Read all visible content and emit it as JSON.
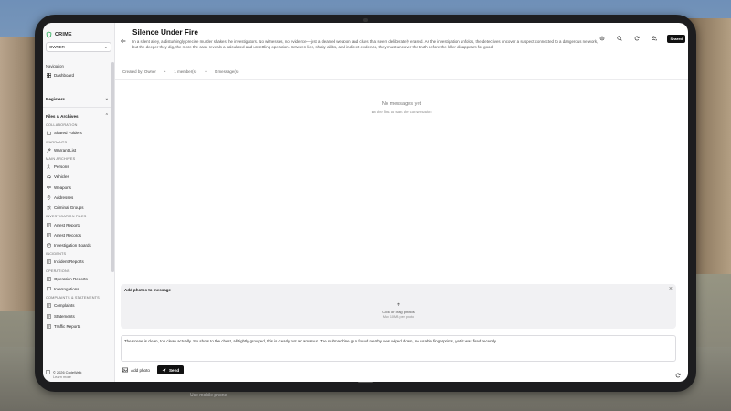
{
  "app": {
    "brand": "CRIME",
    "role": "OWNER"
  },
  "sidebar": {
    "navigation_label": "Navigation",
    "dashboard": "Dashboard",
    "registers": "Registers",
    "files_archives": "Files & Archives",
    "categories": [
      {
        "label": "COLLABORATION",
        "items": [
          {
            "label": "Shared Folders",
            "icon": "folder-icon"
          }
        ]
      },
      {
        "label": "WARRANTS",
        "items": [
          {
            "label": "Warrant List",
            "icon": "hammer-icon"
          }
        ]
      },
      {
        "label": "MAIN ARCHIVES",
        "items": [
          {
            "label": "Persons",
            "icon": "users-icon"
          },
          {
            "label": "Vehicles",
            "icon": "car-icon"
          },
          {
            "label": "Weapons",
            "icon": "gun-icon"
          },
          {
            "label": "Addresses",
            "icon": "pin-icon"
          },
          {
            "label": "Criminal Groups",
            "icon": "group-icon"
          }
        ]
      },
      {
        "label": "INVESTIGATION FILES",
        "items": [
          {
            "label": "Arrest Reports",
            "icon": "document-icon"
          },
          {
            "label": "Arrest Records",
            "icon": "document-icon"
          },
          {
            "label": "Investigation Boards",
            "icon": "board-icon"
          }
        ]
      },
      {
        "label": "INCIDENTS",
        "items": [
          {
            "label": "Incident Reports",
            "icon": "document-icon"
          }
        ]
      },
      {
        "label": "OPERATIONS",
        "items": [
          {
            "label": "Operation Reports",
            "icon": "document-icon"
          },
          {
            "label": "Interrogations",
            "icon": "chat-icon"
          }
        ]
      },
      {
        "label": "COMPLAINTS & STATEMENTS",
        "items": [
          {
            "label": "Complaints",
            "icon": "document-icon"
          },
          {
            "label": "Statements",
            "icon": "document-icon"
          },
          {
            "label": "Traffic Reports",
            "icon": "document-icon"
          }
        ]
      }
    ],
    "footer": {
      "copyright": "© 2026 CodeWalk",
      "learn_more": "Learn more"
    }
  },
  "header": {
    "title": "Silence Under Fire",
    "description": "In a silent alley, a disturbingly precise murder shakes the investigators. No witnesses, no evidence—just a cleaned weapon and clues that seem deliberately erased. As the investigation unfolds, the detectives uncover a suspect connected to a dangerous network, but the deeper they dig, the more the case reveals a calculated and unsettling operation. Between lies, shaky alibis, and indirect evidence, they must uncover the truth before the killer disappears for good.",
    "shared_label": "Shared"
  },
  "meta": {
    "created_by": "Created by: Owner",
    "members": "1 member(s)",
    "messages": "0 message(s)"
  },
  "conversation": {
    "empty_title": "No messages yet",
    "empty_sub": "Be the first to start the conversation"
  },
  "photo_panel": {
    "title": "Add photos to message",
    "drop_text": "Click or drag photos",
    "drop_sub": "Max 10MB per photo"
  },
  "composer": {
    "text": "The scene is clean, too clean actually. Six shots to the chest, all tightly grouped, this is clearly not an amateur. The submachine gun found nearby was wiped down, no usable fingerprints, yet it was fired recently.",
    "add_photo": "Add photo",
    "send": "Send"
  },
  "game": {
    "hint": "Use mobile phone"
  },
  "colors": {
    "brand_green": "#16a34a",
    "dark": "#111111"
  }
}
